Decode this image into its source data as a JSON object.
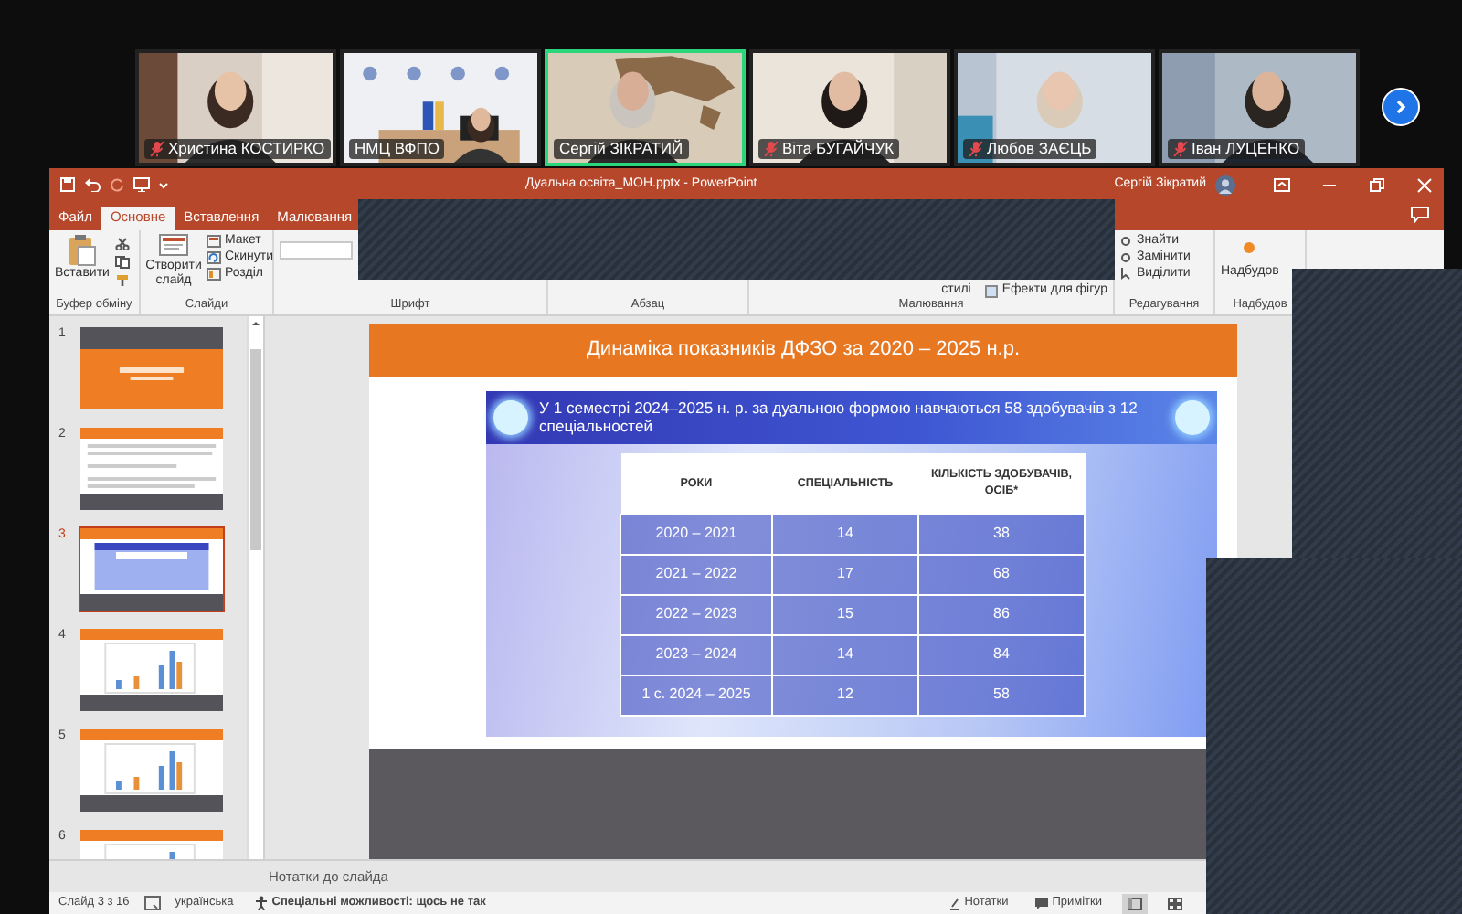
{
  "meeting": {
    "participants": [
      {
        "name": "Христина КОСТИРКО",
        "muted": true,
        "speaking": false
      },
      {
        "name": "НМЦ ВФПО",
        "muted": false,
        "speaking": false
      },
      {
        "name": "Сергій ЗІКРАТИЙ",
        "muted": false,
        "speaking": true
      },
      {
        "name": "Віта БУГАЙЧУК",
        "muted": true,
        "speaking": false
      },
      {
        "name": "Любов ЗАЄЦЬ",
        "muted": true,
        "speaking": false
      },
      {
        "name": "Іван ЛУЦЕНКО",
        "muted": true,
        "speaking": false
      }
    ]
  },
  "powerpoint": {
    "title": "Дуальна освіта_МОН.pptx  -  PowerPoint",
    "user": "Сергій Зікратий",
    "tabs": [
      {
        "label": "Файл",
        "selected": false
      },
      {
        "label": "Основне",
        "selected": true
      },
      {
        "label": "Вставлення",
        "selected": false
      },
      {
        "label": "Малювання",
        "selected": false
      }
    ],
    "ribbon": [
      {
        "kind": "clipboard",
        "label": "Буфер обміну",
        "commands": [
          "Вставити"
        ]
      },
      {
        "kind": "slides",
        "label": "Слайди",
        "commands": [
          "Створити слайд",
          "Макет",
          "Скинути",
          "Розділ"
        ]
      },
      {
        "kind": "font",
        "label": "Шрифт"
      },
      {
        "kind": "paragraph",
        "label": "Абзац"
      },
      {
        "kind": "drawing",
        "label": "Малювання",
        "commands": [
          "стилі",
          "Ефекти для фігур"
        ]
      },
      {
        "kind": "editing",
        "label": "Редагування",
        "commands": [
          "Знайти",
          "Замінити",
          "Виділити"
        ]
      },
      {
        "kind": "addins",
        "label": "Надбудов",
        "commands": [
          "Надбудов"
        ]
      }
    ],
    "slides": [
      {
        "number": "1",
        "kind": "title",
        "selected": false
      },
      {
        "number": "2",
        "kind": "text",
        "selected": false
      },
      {
        "number": "3",
        "kind": "table",
        "selected": true
      },
      {
        "number": "4",
        "kind": "chart",
        "selected": false
      },
      {
        "number": "5",
        "kind": "chart",
        "selected": false
      },
      {
        "number": "6",
        "kind": "chart",
        "selected": false
      }
    ],
    "slide": {
      "title": "Динаміка показників ДФЗО за 2020 – 2025 н.р.",
      "banner": "У 1 семестрі 2024–2025 н. р. за дуальною формою навчаються 58 здобувачів з 12 спеціальностей",
      "table": {
        "columns": [
          "РОКИ",
          "СПЕЦІАЛЬНІСТЬ",
          "КІЛЬКІСТЬ ЗДОБУВАЧІВ, ОСІБ*"
        ],
        "rows": [
          [
            "2020 – 2021",
            "14",
            "38"
          ],
          [
            "2021 – 2022",
            "17",
            "68"
          ],
          [
            "2022 – 2023",
            "15",
            "86"
          ],
          [
            "2023 – 2024",
            "14",
            "84"
          ],
          [
            "1 с. 2024 – 2025",
            "12",
            "58"
          ]
        ]
      }
    },
    "notes_placeholder": "Нотатки до слайда",
    "status_bar": {
      "slide_counter": "Слайд 3 з 16",
      "language": "українська",
      "accessibility": "Спеціальні можливості: щось не так",
      "notes_button": "Нотатки",
      "comments_button": "Примітки",
      "views": [
        {
          "kind": "normal",
          "selected": true
        },
        {
          "kind": "sorter",
          "selected": false
        }
      ]
    }
  }
}
